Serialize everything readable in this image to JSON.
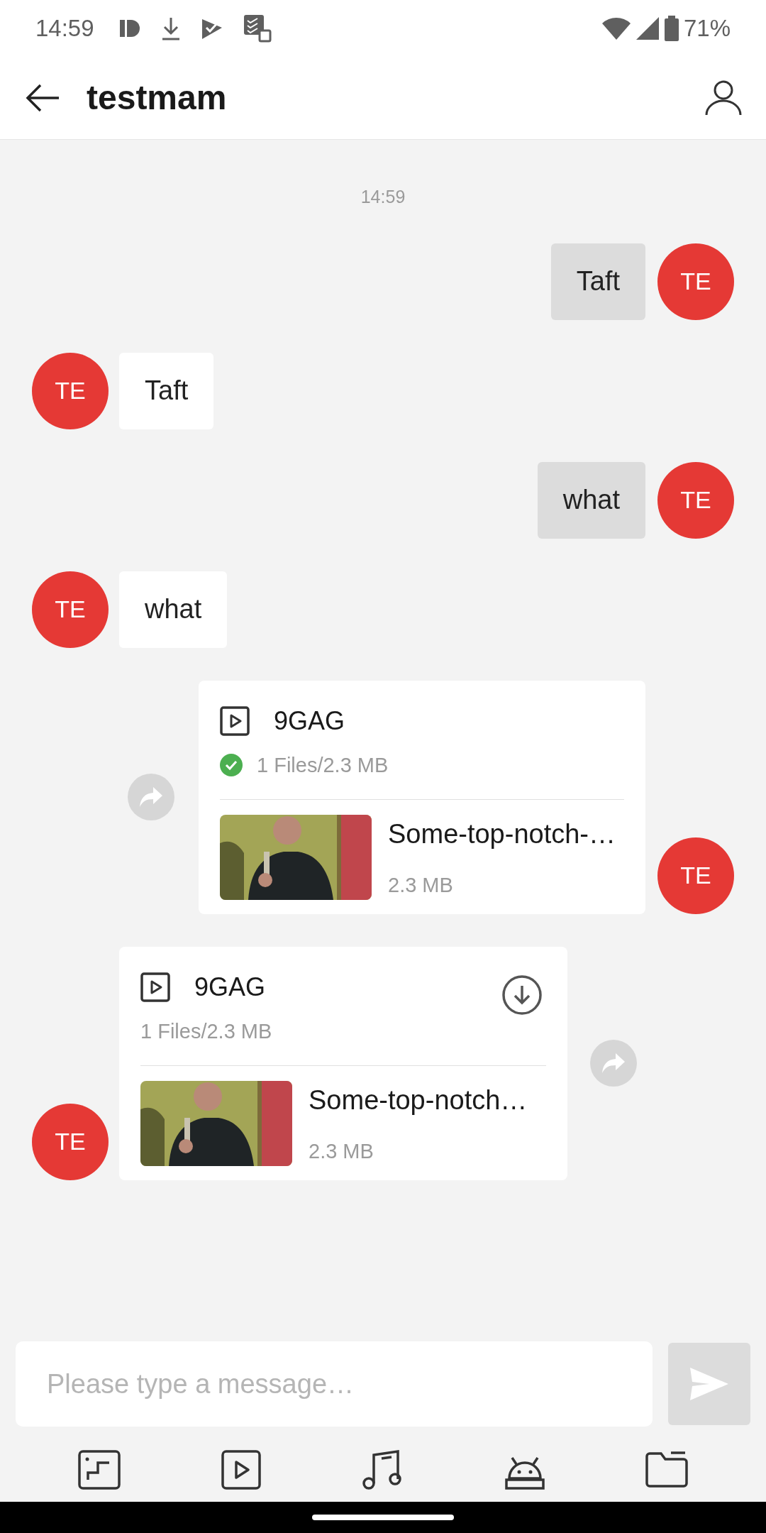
{
  "status_bar": {
    "time": "14:59",
    "battery": "71%"
  },
  "header": {
    "title": "testmam"
  },
  "timestamp": "14:59",
  "messages": [
    {
      "kind": "text",
      "outgoing": true,
      "avatar": "TE",
      "text": "Taft"
    },
    {
      "kind": "text",
      "outgoing": false,
      "avatar": "TE",
      "text": "Taft"
    },
    {
      "kind": "text",
      "outgoing": true,
      "avatar": "TE",
      "text": "what"
    },
    {
      "kind": "text",
      "outgoing": false,
      "avatar": "TE",
      "text": "what"
    },
    {
      "kind": "file",
      "outgoing": true,
      "avatar": "TE",
      "title": "9GAG",
      "summary": "1 Files/2.3 MB",
      "downloaded": true,
      "file_name": "Some-top-notch-…",
      "file_size": "2.3 MB"
    },
    {
      "kind": "file",
      "outgoing": false,
      "avatar": "TE",
      "title": "9GAG",
      "summary": "1 Files/2.3 MB",
      "downloaded": false,
      "file_name": "Some-top-notch…",
      "file_size": "2.3 MB"
    }
  ],
  "composer": {
    "placeholder": "Please type a message…"
  }
}
